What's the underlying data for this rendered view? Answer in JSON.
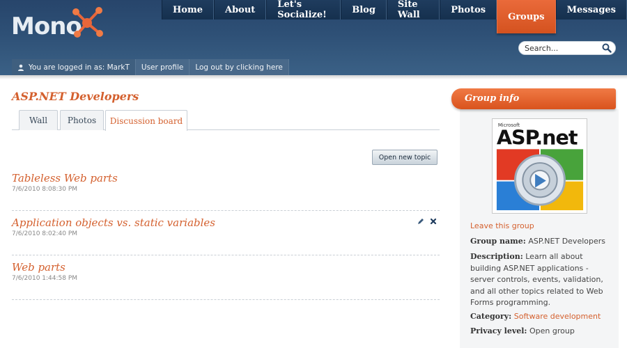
{
  "logo": {
    "text": "Mono"
  },
  "nav": {
    "items": [
      {
        "label": "Home"
      },
      {
        "label": "About"
      },
      {
        "label": "Let's Socialize!"
      },
      {
        "label": "Blog"
      },
      {
        "label": "Site Wall"
      },
      {
        "label": "Photos"
      },
      {
        "label": "Groups",
        "active": true
      },
      {
        "label": "Messages"
      }
    ]
  },
  "search": {
    "placeholder": "Search..."
  },
  "loginbar": {
    "logged_in_text": "You are logged in as: MarkT",
    "profile_link": "User profile",
    "logout_link": "Log out by clicking here"
  },
  "main": {
    "page_title": "ASP.NET Developers",
    "tabs": [
      {
        "label": "Wall"
      },
      {
        "label": "Photos"
      },
      {
        "label": "Discussion board",
        "active": true
      }
    ],
    "open_topic_button": "Open new topic",
    "topics": [
      {
        "title": "Tableless Web parts",
        "date": "7/6/2010 8:08:30 PM"
      },
      {
        "title": "Application objects vs. static variables",
        "date": "7/6/2010 8:02:40 PM"
      },
      {
        "title": "Web parts",
        "date": "7/6/2010 1:44:58 PM"
      }
    ]
  },
  "sidebar": {
    "header": "Group info",
    "logo_text_small": "Microsoft",
    "logo_text_big": "ASP.net",
    "leave_link": "Leave this group",
    "name_label": "Group name:",
    "name_value": "ASP.NET Developers",
    "desc_label": "Description:",
    "desc_value": "Learn all about building ASP.NET applications - server controls, events, validation, and all other topics related to Web Forms programming.",
    "category_label": "Category:",
    "category_value": "Software development",
    "privacy_label": "Privacy level:",
    "privacy_value": "Open group"
  },
  "colors": {
    "accent": "#d4602e",
    "header_bg": "#2e5076",
    "nav_bg": "#1a3556",
    "active_nav": "#e0602b"
  }
}
